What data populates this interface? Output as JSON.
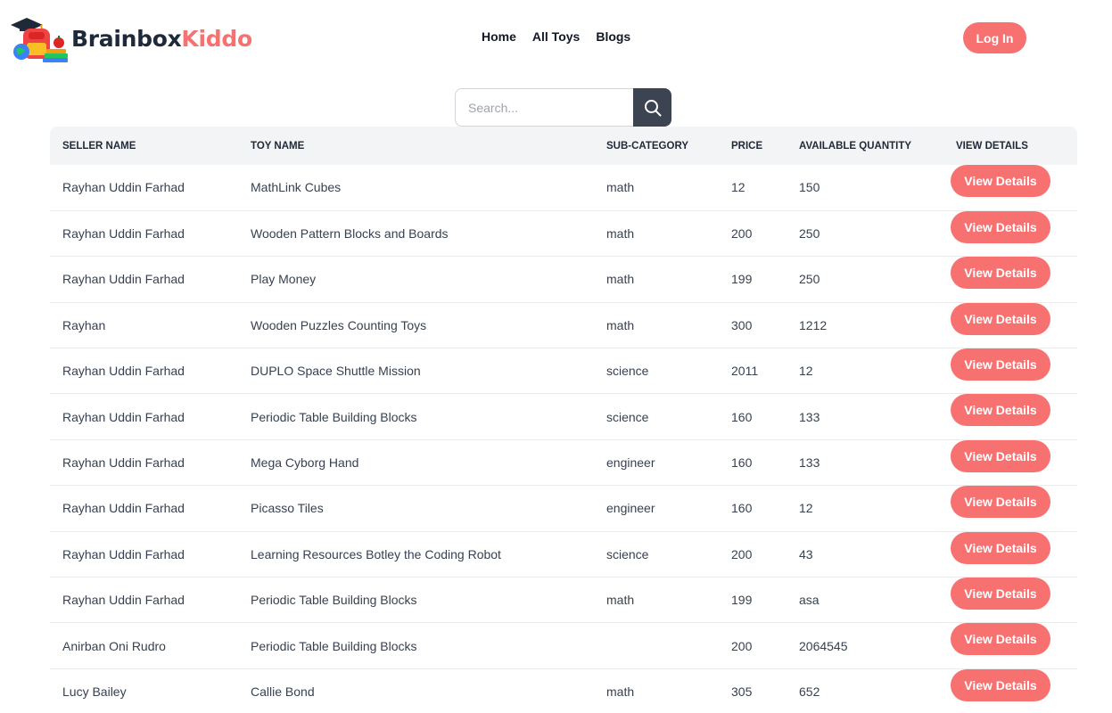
{
  "brand": {
    "part1": "Brainbox",
    "part2": "Kiddo",
    "accent_color": "#f87171"
  },
  "nav": {
    "items": [
      {
        "label": "Home"
      },
      {
        "label": "All Toys"
      },
      {
        "label": "Blogs"
      }
    ]
  },
  "auth": {
    "login_label": "Log In"
  },
  "search": {
    "placeholder": "Search...",
    "icon": "search-icon"
  },
  "table": {
    "headers": [
      "Seller Name",
      "Toy Name",
      "Sub-Category",
      "Price",
      "Available Quantity",
      "View Details"
    ],
    "rows": [
      {
        "seller": "Rayhan Uddin Farhad",
        "toy": "MathLink Cubes",
        "category": "math",
        "price": "12",
        "quantity": "150",
        "action": "View Details"
      },
      {
        "seller": "Rayhan Uddin Farhad",
        "toy": "Wooden Pattern Blocks and Boards",
        "category": "math",
        "price": "200",
        "quantity": "250",
        "action": "View Details"
      },
      {
        "seller": "Rayhan Uddin Farhad",
        "toy": "Play Money",
        "category": "math",
        "price": "199",
        "quantity": "250",
        "action": "View Details"
      },
      {
        "seller": "Rayhan",
        "toy": "Wooden Puzzles Counting Toys",
        "category": "math",
        "price": "300",
        "quantity": "1212",
        "action": "View Details"
      },
      {
        "seller": "Rayhan Uddin Farhad",
        "toy": "DUPLO Space Shuttle Mission",
        "category": "science",
        "price": "2011",
        "quantity": "12",
        "action": "View Details"
      },
      {
        "seller": "Rayhan Uddin Farhad",
        "toy": "Periodic Table Building Blocks",
        "category": "science",
        "price": "160",
        "quantity": "133",
        "action": "View Details"
      },
      {
        "seller": "Rayhan Uddin Farhad",
        "toy": "Mega Cyborg Hand",
        "category": "engineer",
        "price": "160",
        "quantity": "133",
        "action": "View Details"
      },
      {
        "seller": "Rayhan Uddin Farhad",
        "toy": "Picasso Tiles",
        "category": "engineer",
        "price": "160",
        "quantity": "12",
        "action": "View Details"
      },
      {
        "seller": "Rayhan Uddin Farhad",
        "toy": "Learning Resources Botley the Coding Robot",
        "category": "science",
        "price": "200",
        "quantity": "43",
        "action": "View Details"
      },
      {
        "seller": "Rayhan Uddin Farhad",
        "toy": "Periodic Table Building Blocks",
        "category": "math",
        "price": "199",
        "quantity": "asa",
        "action": "View Details"
      },
      {
        "seller": "Anirban Oni Rudro",
        "toy": "Periodic Table Building Blocks",
        "category": "",
        "price": "200",
        "quantity": "2064545",
        "action": "View Details"
      },
      {
        "seller": "Lucy Bailey",
        "toy": "Callie Bond",
        "category": "math",
        "price": "305",
        "quantity": "652",
        "action": "View Details"
      }
    ]
  }
}
